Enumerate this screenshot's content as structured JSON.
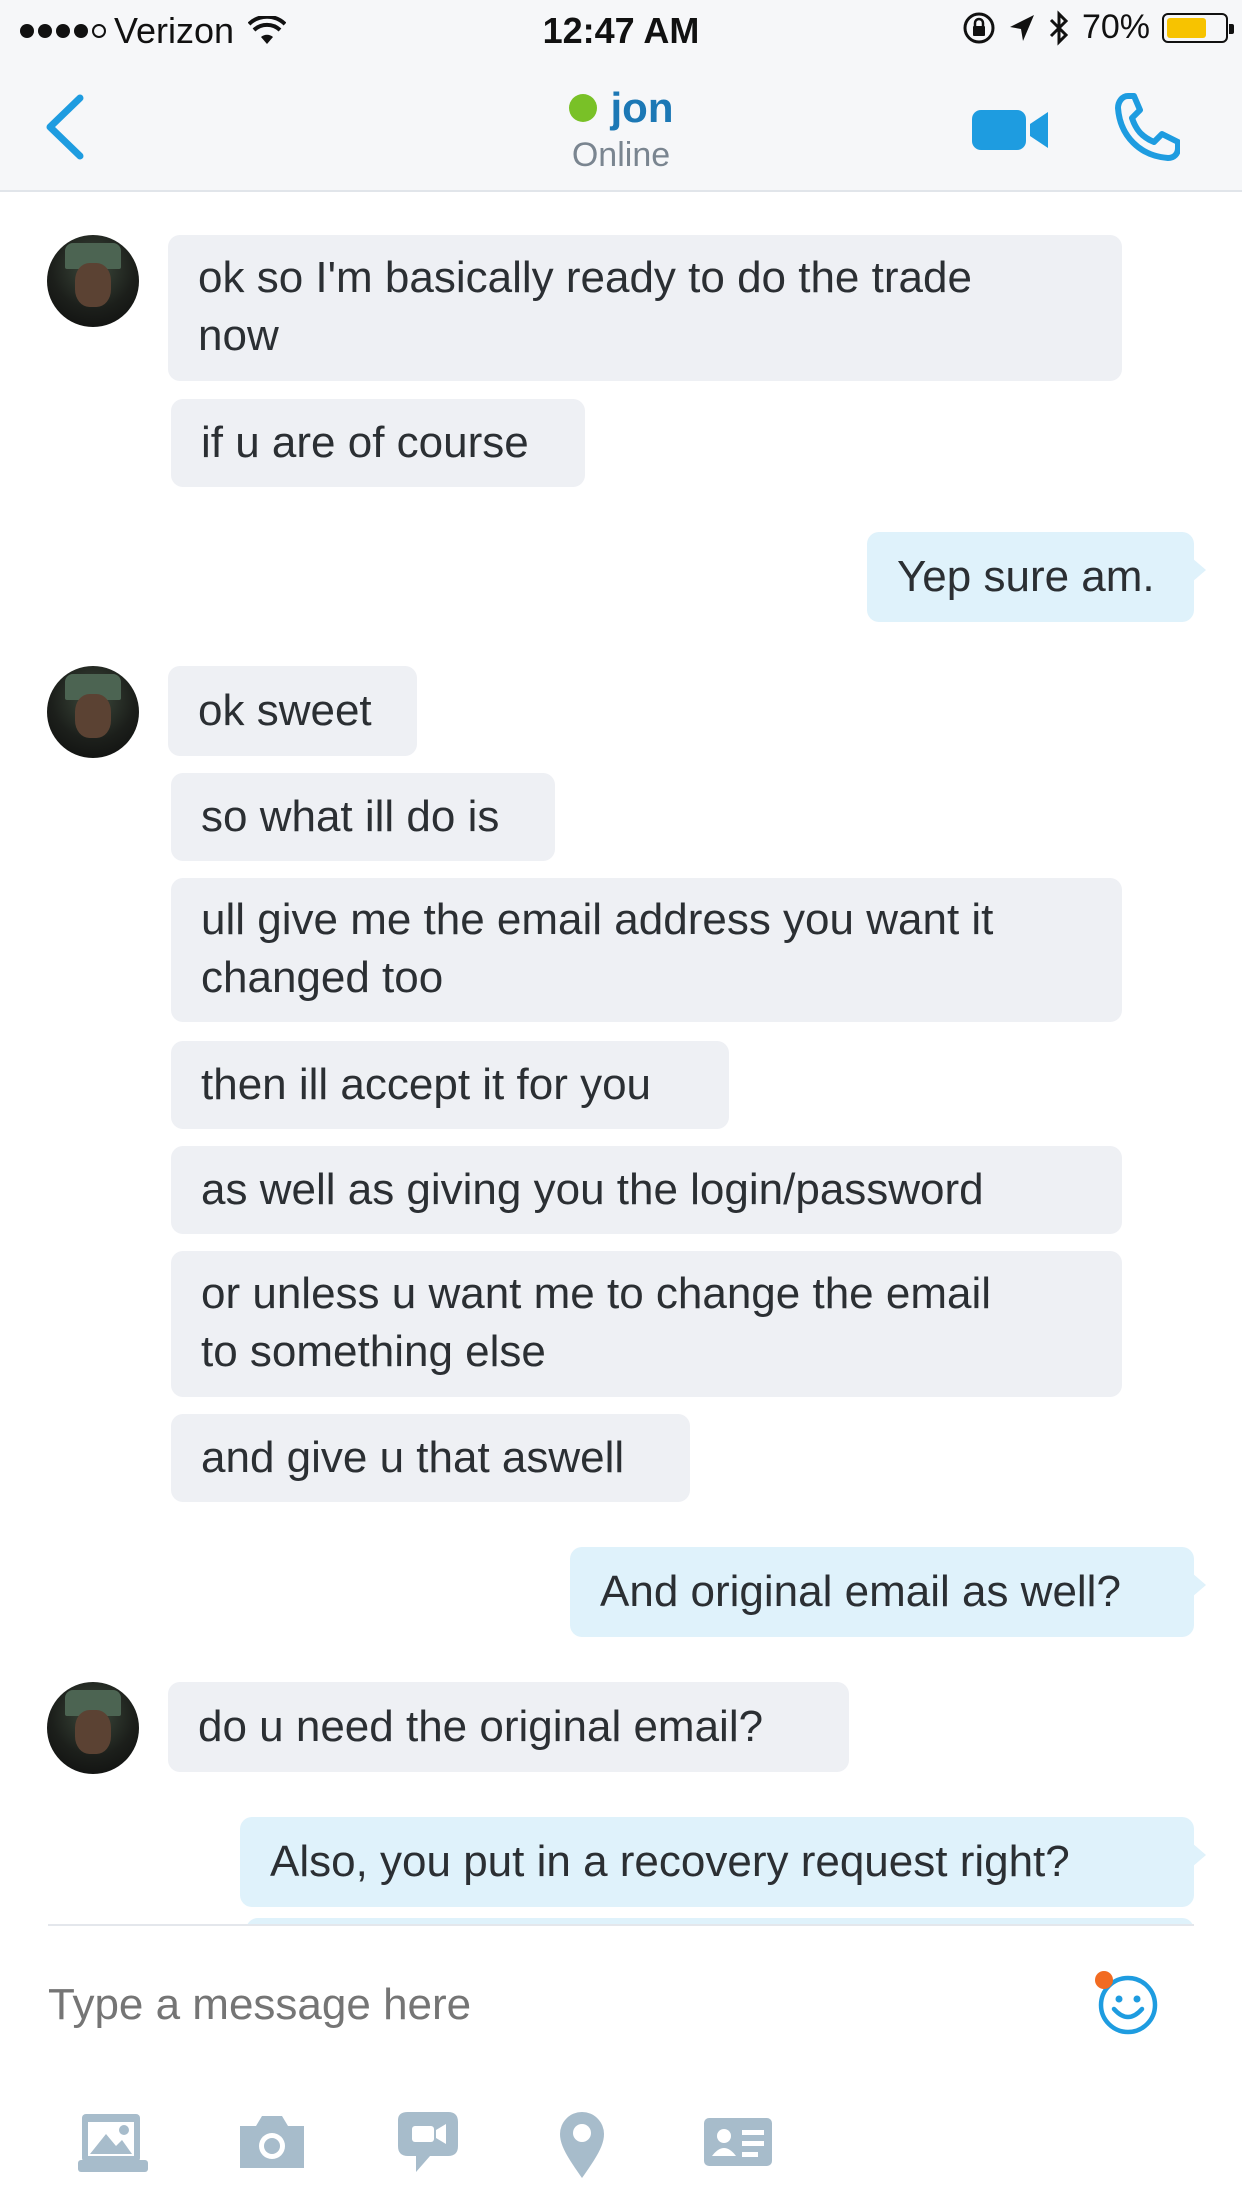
{
  "status_bar": {
    "carrier": "Verizon",
    "time": "12:47 AM",
    "battery_text": "70%",
    "battery_level": 0.7,
    "battery_color": "#f7c300"
  },
  "header": {
    "contact_name": "jon",
    "contact_status": "Online",
    "presence_color": "#79c127",
    "accent_color": "#1e9ce0",
    "icons": [
      "back-chevron-icon",
      "video-camera-icon",
      "phone-icon"
    ]
  },
  "messages": [
    {
      "from": "contact",
      "text_lines": [
        "ok so I'm basically ready to do the trade",
        "now"
      ]
    },
    {
      "from": "contact",
      "text_lines": [
        "if u are of course"
      ]
    },
    {
      "from": "me",
      "text_lines": [
        "Yep sure am."
      ]
    },
    {
      "from": "contact",
      "text_lines": [
        "ok sweet"
      ]
    },
    {
      "from": "contact",
      "text_lines": [
        "so what ill do is"
      ]
    },
    {
      "from": "contact",
      "text_lines": [
        "ull give me the email address you want it",
        "changed too"
      ]
    },
    {
      "from": "contact",
      "text_lines": [
        "then ill accept it for you"
      ]
    },
    {
      "from": "contact",
      "text_lines": [
        "as well as giving you the login/password"
      ]
    },
    {
      "from": "contact",
      "text_lines": [
        "or unless u want me to change the email",
        "to something else"
      ]
    },
    {
      "from": "contact",
      "text_lines": [
        "and give u that aswell"
      ]
    },
    {
      "from": "me",
      "text_lines": [
        "And original email as well?"
      ]
    },
    {
      "from": "contact",
      "text_lines": [
        "do u need the original email?"
      ]
    },
    {
      "from": "me",
      "text_lines": [
        "Also, you put in a recovery request right?"
      ]
    }
  ],
  "composer": {
    "placeholder": "Type a message here",
    "emoji_icon": "smiley-icon",
    "toolbar_icons": [
      "photo-gallery-icon",
      "camera-icon",
      "video-message-icon",
      "location-pin-icon",
      "contact-card-icon"
    ]
  }
}
